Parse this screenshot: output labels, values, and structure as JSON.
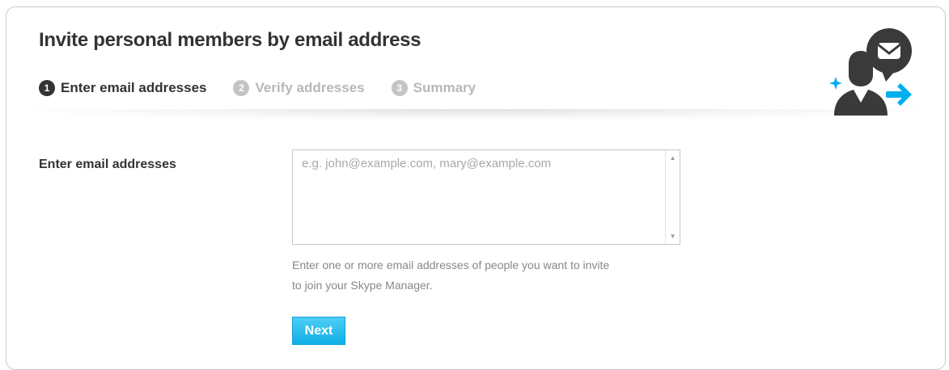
{
  "header": {
    "title": "Invite personal members by email address",
    "steps": [
      {
        "number": "1",
        "label": "Enter email addresses",
        "state": "active"
      },
      {
        "number": "2",
        "label": "Verify addresses",
        "state": "inactive"
      },
      {
        "number": "3",
        "label": "Summary",
        "state": "inactive"
      }
    ],
    "illustration_icons": [
      "person-icon",
      "envelope-speech-bubble-icon",
      "arrow-right-icon",
      "sparkle-icon"
    ]
  },
  "form": {
    "email_label": "Enter email addresses",
    "email_value": "",
    "email_placeholder": "e.g. john@example.com, mary@example.com",
    "help_text_line1": "Enter one or more email addresses of people you want to invite",
    "help_text_line2": "to join your Skype Manager.",
    "next_label": "Next"
  },
  "colors": {
    "accent": "#00aff0",
    "active_step": "#333333",
    "inactive_step": "#b8b8b8",
    "text": "#333333",
    "muted_text": "#888888"
  }
}
